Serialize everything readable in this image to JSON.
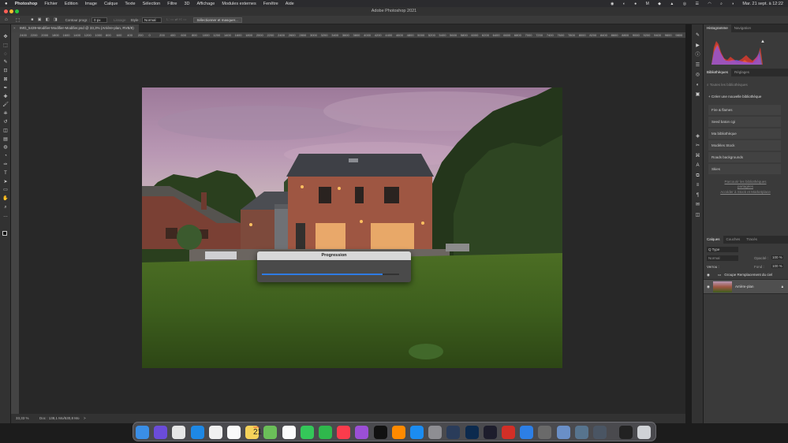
{
  "menubar": {
    "apple": "",
    "items": [
      "Photoshop",
      "Fichier",
      "Edition",
      "Image",
      "Calque",
      "Texte",
      "Sélection",
      "Filtre",
      "3D",
      "Affichage",
      "Modules externes",
      "Fenêtre",
      "Aide"
    ],
    "clock": "Mar. 21 sept. à 12:22"
  },
  "window": {
    "title": "Adobe Photoshop 2021"
  },
  "options": {
    "contour_label": "Contour progr. :",
    "contour_value": "0 px",
    "lissage_label": "Lissage",
    "style_label": "Style :",
    "style_value": "Normal",
    "select_mask_button": "Sélectionner et masquer..."
  },
  "document": {
    "tab_title": "IMG_5439-Modifier-Modifier-Modifier.psd @ 33,3% (Arrière-plan, RVB/8)",
    "ruler_ticks": [
      "2400",
      "2200",
      "2000",
      "1800",
      "1600",
      "1400",
      "1200",
      "1000",
      "800",
      "600",
      "400",
      "200",
      "0",
      "200",
      "400",
      "600",
      "800",
      "1000",
      "1200",
      "1400",
      "1600",
      "1800",
      "2000",
      "2200",
      "2400",
      "2600",
      "2800",
      "3000",
      "3200",
      "3400",
      "3600",
      "3800",
      "4000",
      "4200",
      "4400",
      "4600",
      "4800",
      "5000",
      "5200",
      "5400",
      "5600",
      "5800",
      "6000",
      "6200",
      "6400",
      "6600",
      "6800",
      "7000",
      "7200",
      "7400",
      "7600",
      "7800",
      "8000",
      "8200",
      "8400",
      "8600",
      "8800",
      "9000",
      "9200",
      "9400",
      "9600",
      "9800"
    ]
  },
  "status": {
    "zoom": "33,33 %",
    "doc_info": "Doc : 138,1 Mo/530,8 Mo",
    "arrow": ">"
  },
  "dialog": {
    "title": "Progression",
    "progress": 0.88
  },
  "panels": {
    "histogram_tabs": [
      "Histogramme",
      "Navigation"
    ],
    "library_tabs": [
      "Bibliothèques",
      "Réglages"
    ],
    "library_search_placeholder": "Toutes les bibliothèques",
    "create_library": "Créer une nouvelle bibliothèque",
    "libraries": [
      "Fire & flames",
      "Seed baton cgi",
      "Ma bibliothèque",
      "Modèles Stock",
      "Roads backgrounds",
      "Skies"
    ],
    "links": [
      "Parcourir les bibliothèques partagées",
      "Accéder à Stock et Marketplace"
    ],
    "layers_tabs": [
      "Calques",
      "Couches",
      "Tracés"
    ],
    "layer_filter": "Q Type",
    "blend_mode": "Normal",
    "opacity_label": "Opacité :",
    "opacity_value": "100 %",
    "lock_label": "Verrou :",
    "fill_label": "Fond :",
    "fill_value": "100 %",
    "layers": [
      {
        "name": "Groupe Remplacement du ciel",
        "kind": "group"
      },
      {
        "name": "Arrière-plan",
        "kind": "image"
      }
    ]
  },
  "dock": {
    "calendar_month": "SEPT.",
    "calendar_day": "21"
  },
  "colors": {
    "accent": "#2e7be4",
    "menubar": "#2b2b2e",
    "panel": "#3a3a3a"
  }
}
